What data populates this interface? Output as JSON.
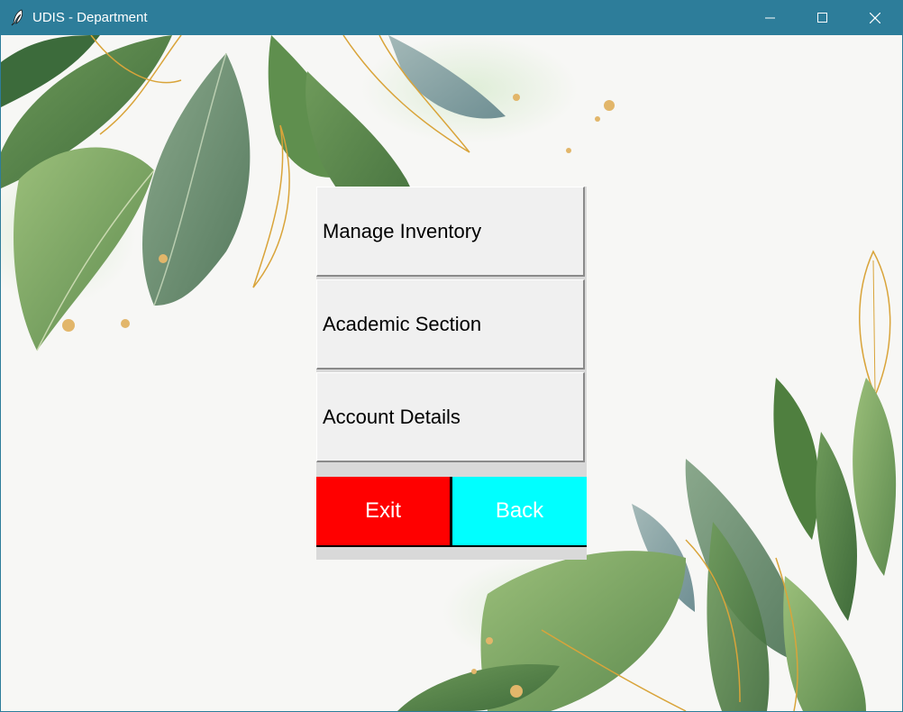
{
  "window": {
    "title": "UDIS - Department",
    "controls": [
      "minimize-icon",
      "maximize-icon",
      "close-icon"
    ]
  },
  "menu": {
    "items": [
      {
        "label": "Manage Inventory"
      },
      {
        "label": "Academic Section"
      },
      {
        "label": "Account Details"
      }
    ],
    "exit_label": "Exit",
    "back_label": "Back"
  },
  "colors": {
    "titlebar": "#2d7d9a",
    "exit_bg": "#ff0000",
    "back_bg": "#00ffff",
    "menu_bg": "#f0f0f0"
  }
}
